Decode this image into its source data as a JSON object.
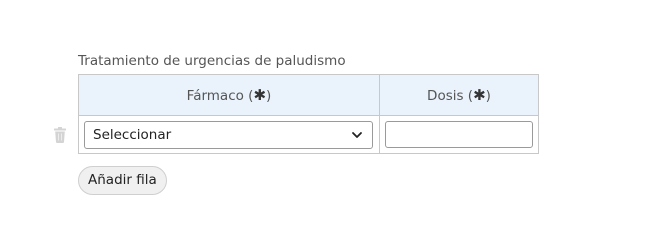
{
  "section": {
    "title": "Tratamiento de urgencias de paludismo"
  },
  "table": {
    "columns": [
      {
        "label": "Fármaco (",
        "required_mark": "✱",
        "suffix": ")"
      },
      {
        "label": "Dosis (",
        "required_mark": "✱",
        "suffix": ")"
      }
    ],
    "rows": [
      {
        "drug_select_value": "Seleccionar",
        "dose_value": ""
      }
    ]
  },
  "actions": {
    "add_row_label": "Añadir fila"
  },
  "icons": {
    "delete_row": "trash-icon",
    "select_arrow": "chevron-down-icon"
  },
  "colors": {
    "header_bg": "#eaf2fb",
    "border": "#c8c8c8",
    "trash": "#d4d4d4",
    "button_bg": "#f0f0f0"
  }
}
